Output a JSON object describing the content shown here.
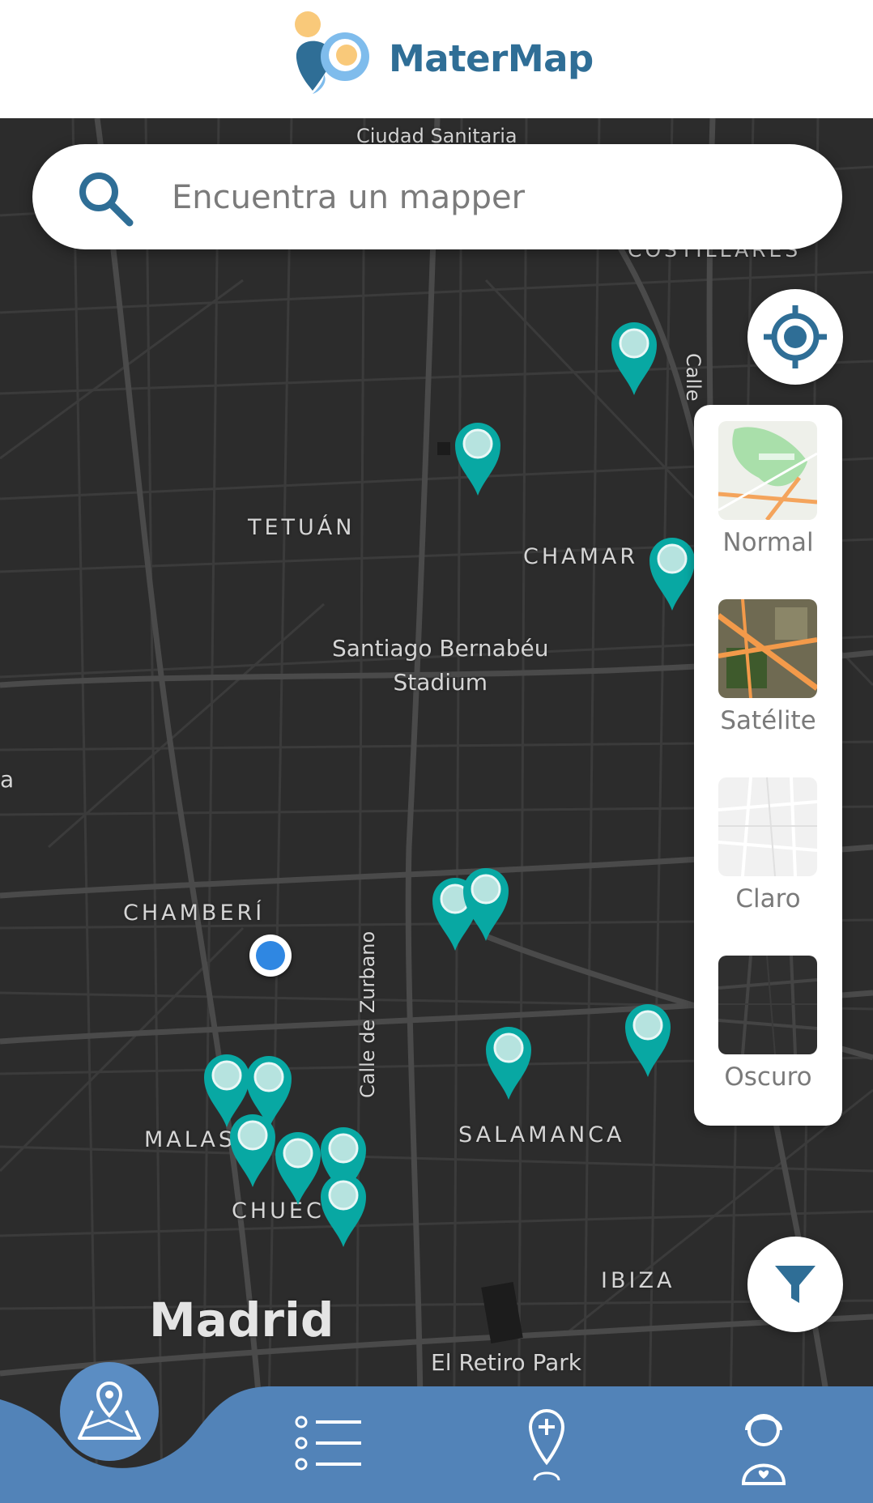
{
  "app": {
    "name": "MaterMap"
  },
  "search": {
    "placeholder": "Encuentra un mapper"
  },
  "map": {
    "labels": {
      "ciudad_sanitaria": "Ciudad Sanitaria",
      "costillares": "COSTILLARES",
      "tetuan": "TETUÁN",
      "chamartin": "CHAMAR",
      "bernabeu": "Santiago Bernabéu",
      "stadium": "Stadium",
      "chamberi": "CHAMBERÍ",
      "zurbano": "Calle de Zurbano",
      "salamanca": "SALAMANCA",
      "malasana": "MALAS",
      "chueca": "CHUEC",
      "ibiza": "IBIZA",
      "madrid": "Madrid",
      "retiro": "El Retiro Park",
      "calle_right": "Calle",
      "edge_a": "a"
    }
  },
  "layers": [
    {
      "name": "Normal",
      "icon": "normal-map-thumb"
    },
    {
      "name": "Satélite",
      "icon": "satellite-map-thumb"
    },
    {
      "name": "Claro",
      "icon": "light-map-thumb"
    },
    {
      "name": "Oscuro",
      "icon": "dark-map-thumb"
    }
  ],
  "nav": [
    {
      "icon": "map-location-icon",
      "active": true
    },
    {
      "icon": "list-icon",
      "active": false
    },
    {
      "icon": "add-location-icon",
      "active": false
    },
    {
      "icon": "support-agent-icon",
      "active": false
    }
  ],
  "colors": {
    "brand": "#2f6e96",
    "pin": "#08a8a3",
    "pin_dot": "#b6e3df",
    "nav_bar": "#5283b8",
    "user_location": "#2f87e2",
    "map_bg": "#2c2c2c"
  }
}
